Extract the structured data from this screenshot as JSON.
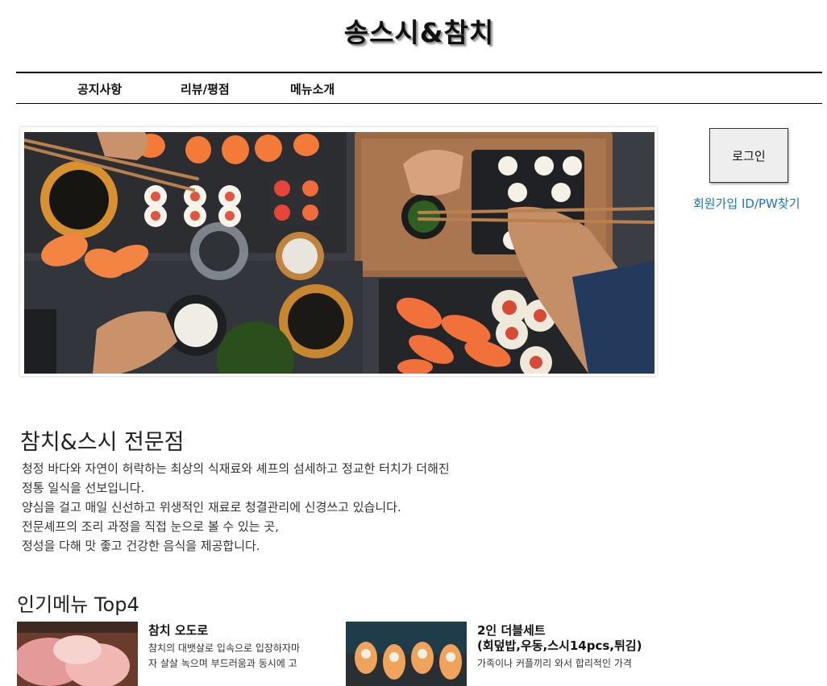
{
  "header": {
    "title": "송스시&참치"
  },
  "nav": {
    "items": [
      {
        "label": "공지사항"
      },
      {
        "label": "리뷰/평점"
      },
      {
        "label": "메뉴소개"
      }
    ]
  },
  "hero": {
    "image": "sushi-table-photo"
  },
  "auth": {
    "login_label": "로그인",
    "signup_label": "회원가입",
    "find_label": "ID/PW찾기"
  },
  "intro": {
    "title": "참치&스시 전문점",
    "lines": [
      "청정 바다와 자연이 허락하는 최상의 식재료와 셰프의 섬세하고 정교한 터치가 더해진",
      "정통 일식을 선보입니다.",
      "양심을 걸고 매일 신선하고 위생적인 재료로 청결관리에 신경쓰고 있습니다.",
      "전문셰프의 조리 과정을 직접 눈으로 볼 수 있는 곳,",
      "정성을 다해 맛 좋고 건강한 음식을 제공합니다."
    ]
  },
  "popular": {
    "title": "인기메뉴 Top4",
    "items": [
      {
        "name": "참치 오도로",
        "desc": [
          "참치의 대뱃살로 입속으로 입장하자마",
          "자 살살 녹으며 부드러움과 동시에 고"
        ]
      },
      {
        "name_lines": [
          "2인 더블세트",
          "(회덮밥,우동,스시14pcs,튀김)"
        ],
        "desc": [
          "가족이나 커플끼리 와서 합리적인 가격"
        ]
      }
    ]
  },
  "colors": {
    "link": "#1a73c8",
    "title_shadow": "#9a9a9a",
    "button_bg": "#eeeeee"
  }
}
